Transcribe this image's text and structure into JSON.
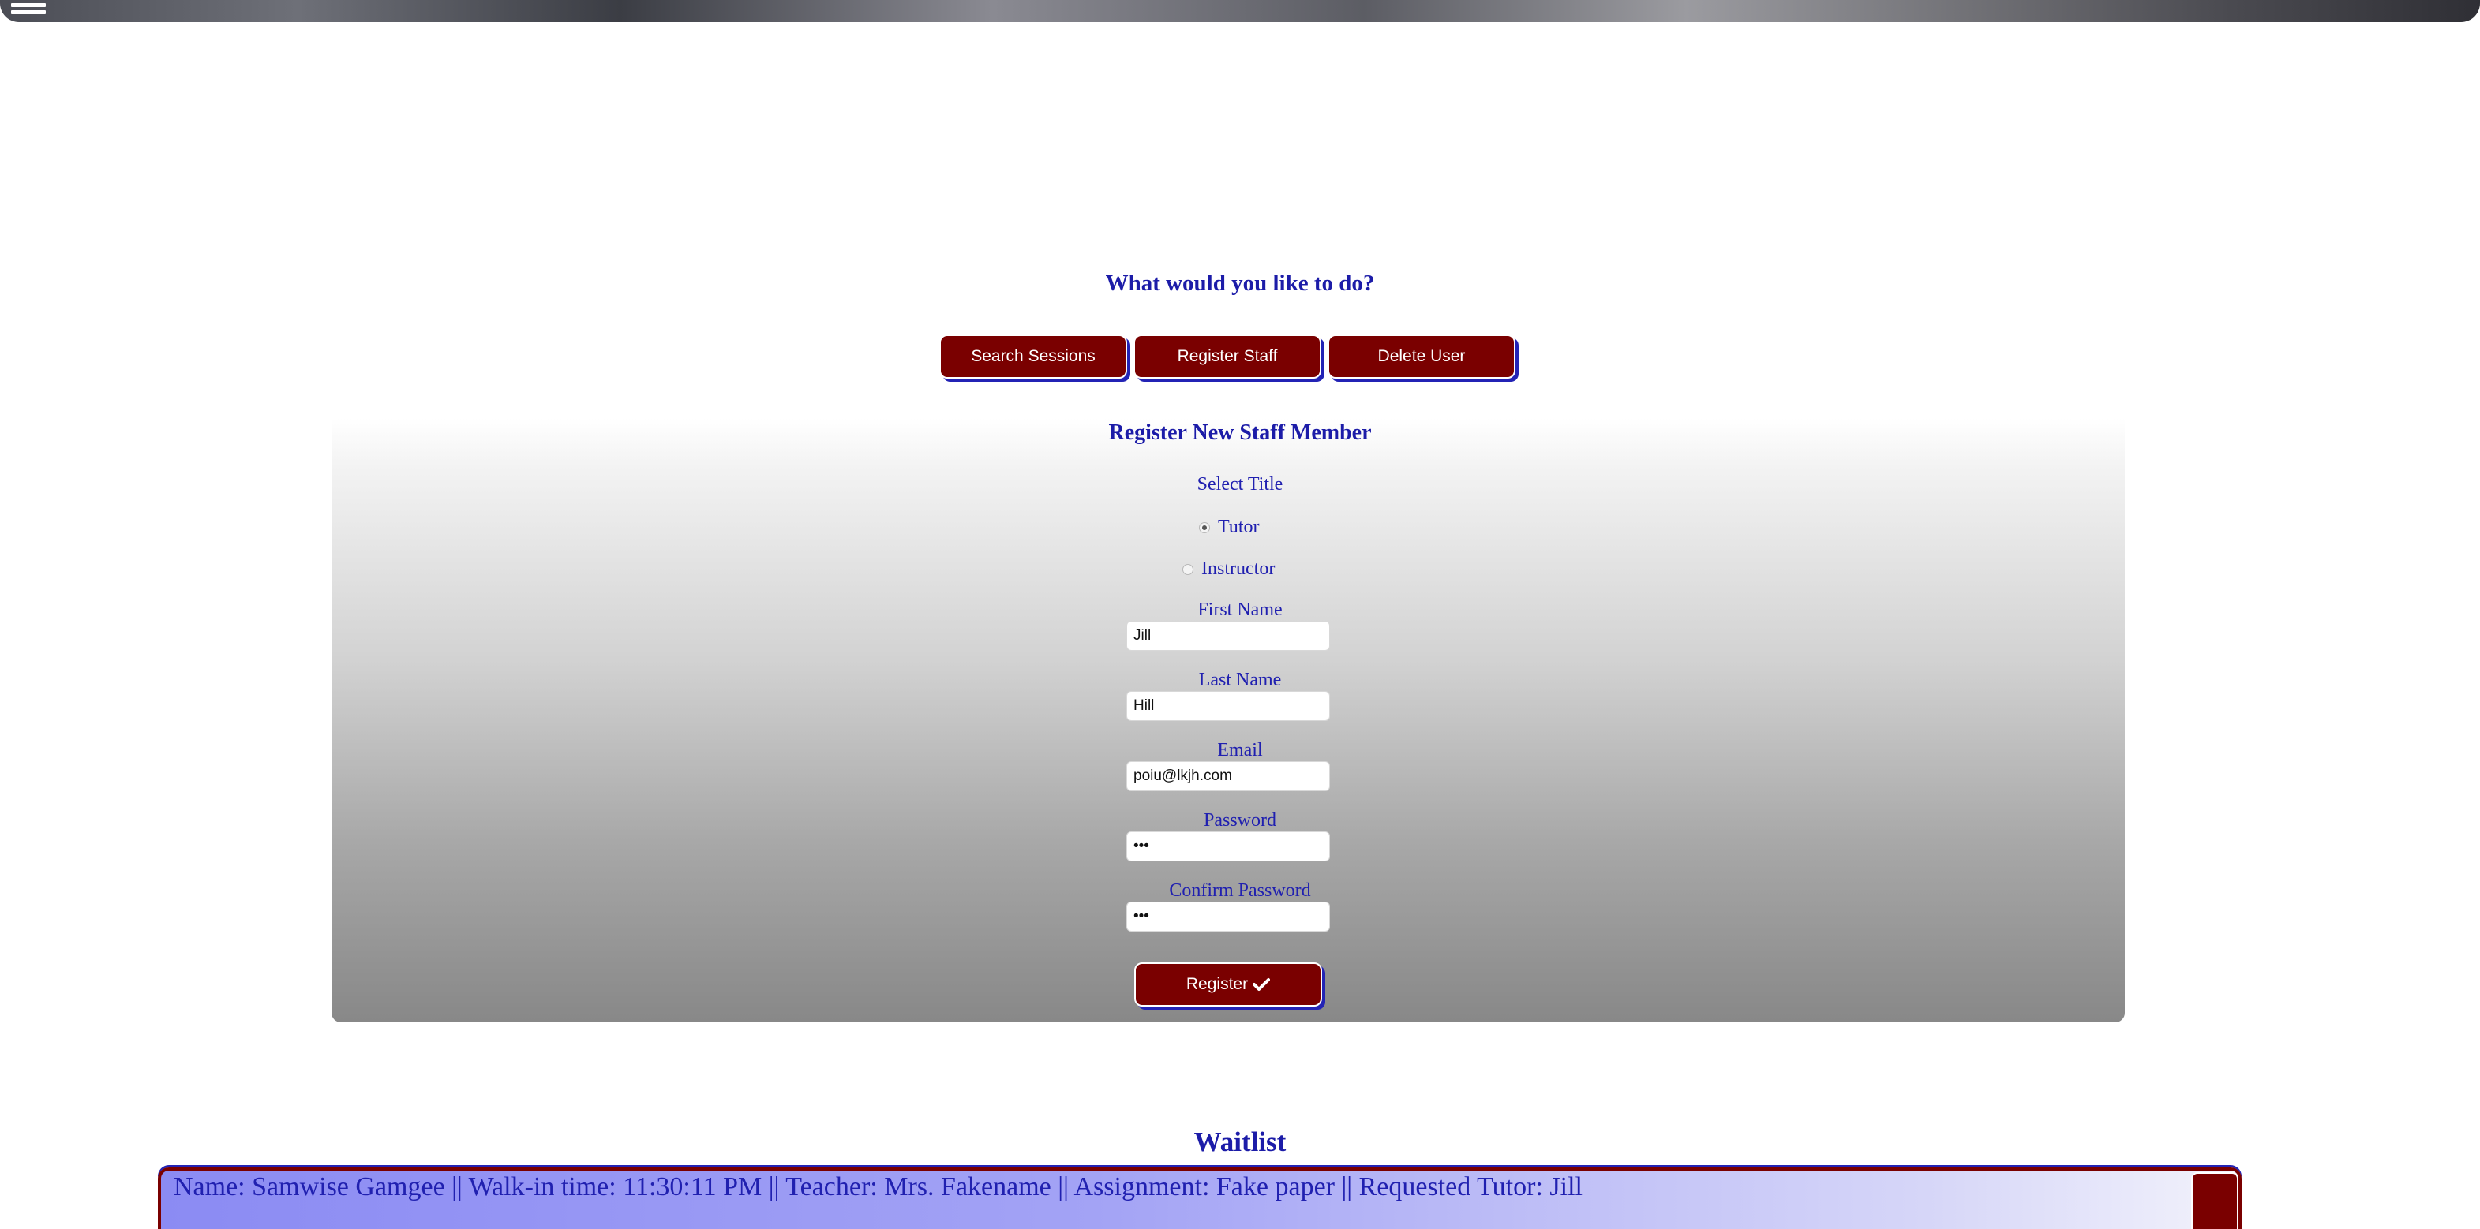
{
  "header": {
    "menu_icon": "hamburger-menu-icon"
  },
  "prompt": "What would you like to do?",
  "actions": {
    "search_sessions": "Search Sessions",
    "register_staff": "Register Staff",
    "delete_user": "Delete User"
  },
  "form": {
    "title": "Register New Staff Member",
    "select_title_label": "Select Title",
    "options": [
      {
        "label": "Tutor",
        "checked": true
      },
      {
        "label": "Instructor",
        "checked": false
      }
    ],
    "first_name_label": "First Name",
    "first_name_value": "Jill",
    "last_name_label": "Last Name",
    "last_name_value": "Hill",
    "email_label": "Email",
    "email_value": "poiu@lkjh.com",
    "password_label": "Password",
    "password_value": "•••",
    "confirm_password_label": "Confirm Password",
    "confirm_password_value": "•••",
    "register_label": "Register",
    "register_icon": "check-icon"
  },
  "waitlist": {
    "title": "Waitlist",
    "entries": [
      "Name: Samwise Gamgee || Walk-in time: 11:30:11 PM || Teacher: Mrs. Fakename || Assignment: Fake paper || Requested Tutor: Jill"
    ]
  },
  "colors": {
    "accent": "#7a0000",
    "text_blue": "#1c1ca8",
    "shadow_blue": "#2323b5"
  }
}
